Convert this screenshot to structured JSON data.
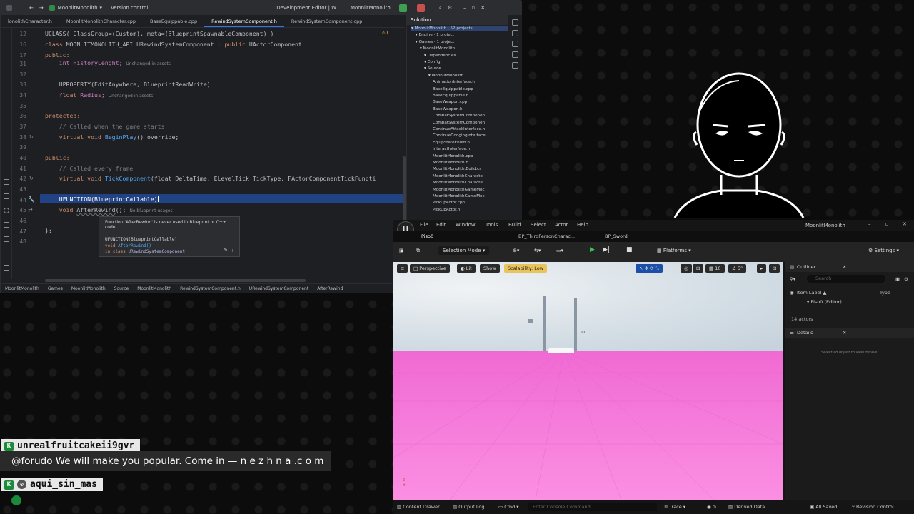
{
  "ide": {
    "project": "MoonlitMonolith",
    "vcs": "Version control",
    "config": "Development Editor | W...",
    "target": "MoonlitMonolith",
    "tabs": [
      "lonolithCharacter.h",
      "MoonlitMonolithCharacter.cpp",
      "BaseEquippable.cpp",
      "RewindSystemComponent.h",
      "RewindSystemComponent.cpp"
    ],
    "active_tab": 3,
    "line_numbers": [
      "12",
      "16",
      "17",
      "31",
      "32",
      "33",
      "34",
      "35",
      "36",
      "37",
      "38",
      "39",
      "40",
      "41",
      "42",
      "43",
      "44",
      "45",
      "46",
      "47",
      "48"
    ],
    "code": {
      "l12": "UCLASS( ClassGroup=(Custom), meta=(BlueprintSpawnableComponent) )",
      "l16a": "class ",
      "l16b": "MOONLITMONOLITH_API URewindSystemComponent : ",
      "l16c": "public ",
      "l16d": "UActorComponent",
      "l17": "public:",
      "l31": "    int HistoryLenght;",
      "l31_hint": "Unchanged in assets",
      "l33": "    UPROPERTY(EditAnywhere, BlueprintReadWrite)",
      "l34a": "    float ",
      "l34b": "Radius;",
      "l34_hint": "Unchanged in assets",
      "l36": "protected:",
      "l37": "    // Called when the game starts",
      "l38a": "    virtual void ",
      "l38b": "BeginPlay",
      "l38c": "() override;",
      "l40": "public:",
      "l41": "    // Called every frame",
      "l42a": "    virtual void ",
      "l42b": "TickComponent",
      "l42c": "(float DeltaTime, ELevelTick TickType, FActorComponentTickFuncti",
      "l44": "    UFUNCTION(BlueprintCallable)",
      "l45a": "    void ",
      "l45b": "AfterRewind",
      "l45c": "();",
      "l45_hint": "No blueprint usages",
      "l47": "};"
    },
    "warning": "1",
    "tooltip": {
      "message": "Function 'AfterRewind' is never used in Blueprint or C++ code",
      "code1": "UFUNCTION(BlueprintCallable)",
      "code2a": "void ",
      "code2b": "AfterRewind()",
      "code3a": "  in class ",
      "code3b": "URewindSystemComponent"
    },
    "breadcrumb": [
      "MoonlitMonolith",
      "Games",
      "MoonlitMonolith",
      "Source",
      "MoonlitMonolith",
      "RewindSystemComponent.h",
      "URewindSystemComponent",
      "AfterRewind"
    ],
    "solution": {
      "title": "Solution",
      "items": [
        {
          "t": "MoonlitMonolith · 52 projects",
          "d": 0,
          "sel": true
        },
        {
          "t": "Engine · 1 project",
          "d": 1
        },
        {
          "t": "Games · 1 project",
          "d": 1
        },
        {
          "t": "MoonlitMonolith",
          "d": 2
        },
        {
          "t": "Dependencies",
          "d": 3
        },
        {
          "t": "Config",
          "d": 3
        },
        {
          "t": "Source",
          "d": 3
        },
        {
          "t": "MoonlitMonolith",
          "d": 4
        },
        {
          "t": "AnimationInterface.h",
          "d": 5
        },
        {
          "t": "BaseEquippable.cpp",
          "d": 5
        },
        {
          "t": "BaseEquippable.h",
          "d": 5
        },
        {
          "t": "BaseWeapon.cpp",
          "d": 5
        },
        {
          "t": "BaseWeapon.h",
          "d": 5
        },
        {
          "t": "CombatSystemComponen",
          "d": 5
        },
        {
          "t": "CombatSystemComponen",
          "d": 5
        },
        {
          "t": "ContinueAttackInterface.h",
          "d": 5
        },
        {
          "t": "ContinueDodgingInterface",
          "d": 5
        },
        {
          "t": "EquipStateEnum.h",
          "d": 5
        },
        {
          "t": "InteractInterface.h",
          "d": 5
        },
        {
          "t": "MoonlitMonolith.cpp",
          "d": 5
        },
        {
          "t": "MoonlitMonolith.h",
          "d": 5
        },
        {
          "t": "MoonlitMonolith.Build.cs",
          "d": 5
        },
        {
          "t": "MoonlitMonolithCharacte",
          "d": 5
        },
        {
          "t": "MoonlitMonolithCharacte",
          "d": 5
        },
        {
          "t": "MoonlitMonolithGameMoc",
          "d": 5
        },
        {
          "t": "MoonlitMonolithGameMoc",
          "d": 5
        },
        {
          "t": "PickUpActor.cpp",
          "d": 5
        },
        {
          "t": "PickUpActor.h",
          "d": 5
        }
      ]
    }
  },
  "ue": {
    "menu": [
      "File",
      "Edit",
      "Window",
      "Tools",
      "Build",
      "Select",
      "Actor",
      "Help"
    ],
    "project": "MoonlitMonolith",
    "tabs": [
      "Piso0",
      "BP_ThirdPersonCharac...",
      "BP_Sword"
    ],
    "selection_mode": "Selection Mode",
    "platforms": "Platforms",
    "settings": "Settings",
    "viewport": {
      "perspective": "Perspective",
      "lit": "Lit",
      "show": "Show",
      "scalability": "Scalability: Low",
      "snap_value": "10",
      "angle": "5°"
    },
    "outliner": {
      "title": "Outliner",
      "search": "Search",
      "col_label": "Item Label ▲",
      "col_type": "Type",
      "row": "Piso0 (Editor)",
      "actors": "14 actors"
    },
    "details": {
      "title": "Details",
      "empty": "Select an object to view details"
    },
    "bottom": {
      "content_drawer": "Content Drawer",
      "output_log": "Output Log",
      "cmd": "Cmd",
      "console": "Enter Console Command",
      "trace": "Trace",
      "derived": "Derived Data",
      "saved": "All Saved",
      "revision": "Revision Control"
    }
  },
  "chat": {
    "user1": "unrealfruitcakeii9gvr",
    "message1": "@forudo We will make you popular. Come in — n e z h n a .c o m",
    "user2": "aqui_sin_mas"
  },
  "colors": {
    "accent": "#3574f0",
    "floor": "#f47ad6",
    "kick": "#1b8a3a"
  }
}
